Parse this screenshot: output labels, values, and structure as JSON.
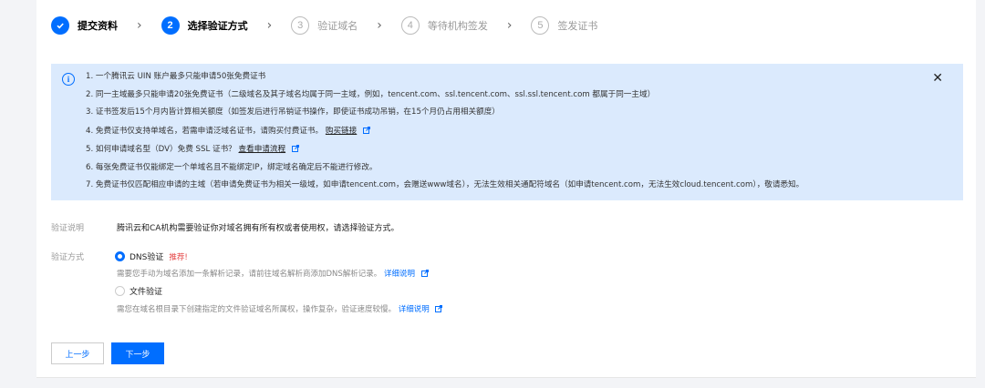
{
  "steps": [
    {
      "label": "提交资料",
      "state": "done"
    },
    {
      "label": "选择验证方式",
      "state": "active",
      "num": "2"
    },
    {
      "label": "验证域名",
      "state": "todo",
      "num": "3"
    },
    {
      "label": "等待机构签发",
      "state": "todo",
      "num": "4"
    },
    {
      "label": "签发证书",
      "state": "todo",
      "num": "5"
    }
  ],
  "step_arrow": "›",
  "info": {
    "close": "✕",
    "items": [
      {
        "text": "1. 一个腾讯云 UIN 账户最多只能申请50张免费证书"
      },
      {
        "text": "2. 同一主域最多只能申请20张免费证书（二级域名及其子域名均属于同一主域，例如，tencent.com、ssl.tencent.com、ssl.ssl.tencent.com 都属于同一主域）"
      },
      {
        "text": "3. 证书签发后15个月内皆计算相关额度（如签发后进行吊销证书操作，即使证书成功吊销，在15个月仍占用相关额度）"
      },
      {
        "text": "4. 免费证书仅支持单域名，若需申请泛域名证书，请购买付费证书。",
        "link": "购买链接"
      },
      {
        "text": "5. 如何申请域名型（DV）免费 SSL 证书？",
        "link": "查看申请流程"
      },
      {
        "text": "6. 每张免费证书仅能绑定一个单域名且不能绑定IP，绑定域名确定后不能进行修改。"
      },
      {
        "text": "7. 免费证书仅匹配相应申请的主域（若申请免费证书为相关一级域，如申请tencent.com，会赠送www域名），无法生效相关通配符域名（如申请tencent.com，无法生效cloud.tencent.com），敬请悉知。"
      }
    ]
  },
  "form": {
    "desc_label": "验证说明",
    "desc_value": "腾讯云和CA机构需要验证你对域名拥有所有权或者使用权，请选择验证方式。",
    "method_label": "验证方式",
    "dns_label": "DNS验证",
    "dns_recommend": "推荐!",
    "dns_hint": "需要您手动为域名添加一条解析记录，请前往域名解析商添加DNS解析记录。",
    "dns_detail": "详细说明",
    "file_label": "文件验证",
    "file_hint": "需您在域名根目录下创建指定的文件验证域名所属权，操作复杂，验证速度较慢。",
    "file_detail": "详细说明"
  },
  "buttons": {
    "prev": "上一步",
    "next": "下一步"
  },
  "colors": {
    "accent": "#006eff",
    "info_bg": "#dbeafd",
    "recommend": "#e54545"
  }
}
